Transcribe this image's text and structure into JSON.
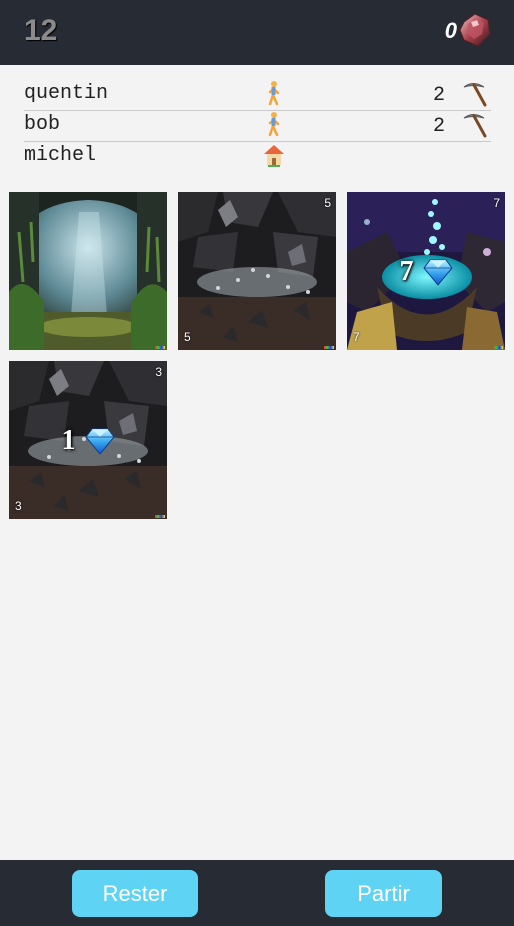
{
  "header": {
    "round": "12",
    "gem_count": "0",
    "gem_icon": "ruby-gem-icon"
  },
  "players": [
    {
      "name": "quentin",
      "status_icon": "walking-person-icon",
      "score": "2",
      "tool_icon": "pickaxe-icon"
    },
    {
      "name": "bob",
      "status_icon": "walking-person-icon",
      "score": "2",
      "tool_icon": "pickaxe-icon"
    },
    {
      "name": "michel",
      "status_icon": "house-icon",
      "score": "",
      "tool_icon": ""
    }
  ],
  "cards": [
    {
      "scene": "cave-entrance",
      "top_right": "",
      "bottom_left": "",
      "gems_on_card": ""
    },
    {
      "scene": "crystal-rubble",
      "top_right": "5",
      "bottom_left": "5",
      "gems_on_card": ""
    },
    {
      "scene": "glowing-treasure",
      "top_right": "7",
      "bottom_left": "7",
      "gems_on_card": "7"
    },
    {
      "scene": "crystal-rubble",
      "top_right": "3",
      "bottom_left": "3",
      "gems_on_card": "1"
    }
  ],
  "actions": {
    "stay_label": "Rester",
    "leave_label": "Partir"
  },
  "colors": {
    "bar": "#272b33",
    "button": "#5fd3f3",
    "background": "#f3f3f3"
  }
}
